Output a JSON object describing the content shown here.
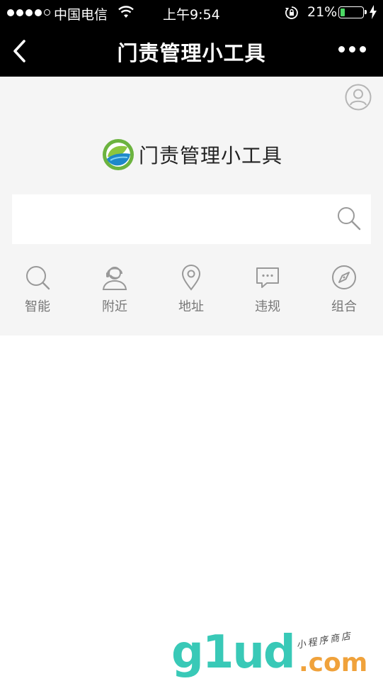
{
  "status_bar": {
    "carrier": "中国电信",
    "time": "上午9:54",
    "battery_percent": "21%",
    "battery_level": 0.21,
    "signal_bars_filled": 4,
    "signal_bars_total": 5
  },
  "nav": {
    "title": "门责管理小工具",
    "back_icon": "chevron-left-icon",
    "more_icon": "more-dots-icon"
  },
  "brand": {
    "name": "门责管理小工具"
  },
  "search": {
    "placeholder": ""
  },
  "categories": [
    {
      "label": "智能",
      "icon": "search-icon"
    },
    {
      "label": "附近",
      "icon": "customer-service-icon"
    },
    {
      "label": "地址",
      "icon": "location-pin-icon"
    },
    {
      "label": "违规",
      "icon": "message-icon"
    },
    {
      "label": "组合",
      "icon": "compass-icon"
    }
  ],
  "watermark": {
    "main": "g1ud",
    "suffix": ".com",
    "sub": "小程序商店"
  },
  "colors": {
    "nav_bg": "#000000",
    "panel_bg": "#f5f5f5",
    "icon_gray": "#999999",
    "battery_green": "#4cd964",
    "watermark_teal": "#39c9b7",
    "watermark_orange": "#f0a23b"
  }
}
